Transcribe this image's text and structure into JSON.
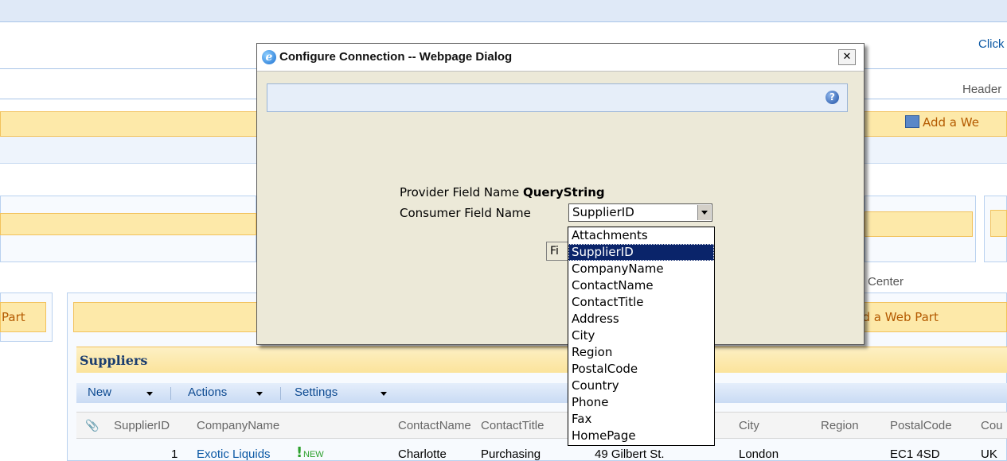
{
  "top_right_link": "Click",
  "header_label": "Header",
  "add_web_part_top": "Add a We",
  "center_label": "Center",
  "left_part_label": "Part",
  "add_web_part_center": "dd a Web Part",
  "dialog": {
    "title": "Configure Connection -- Webpage Dialog",
    "close_glyph": "✕",
    "provider_label": "Provider Field Name",
    "provider_value": "QueryString",
    "consumer_label": "Consumer Field Name",
    "consumer_selected": "SupplierID",
    "finish_button_partial": "Fi",
    "options": [
      "Attachments",
      "SupplierID",
      "CompanyName",
      "ContactName",
      "ContactTitle",
      "Address",
      "City",
      "Region",
      "PostalCode",
      "Country",
      "Phone",
      "Fax",
      "HomePage"
    ],
    "selected_index": 1
  },
  "list": {
    "title": "Suppliers",
    "toolbar": {
      "new": "New",
      "actions": "Actions",
      "settings": "Settings"
    },
    "columns": [
      "SupplierID",
      "CompanyName",
      "ContactName",
      "ContactTitle",
      "City",
      "Region",
      "PostalCode",
      "Cou"
    ],
    "row": {
      "supplier_id": "1",
      "company": "Exotic Liquids",
      "new_badge": "NEW",
      "contact_name": "Charlotte",
      "contact_title": "Purchasing",
      "address": "49 Gilbert St.",
      "city": "London",
      "postal": "EC1 4SD",
      "country": "UK"
    }
  },
  "colors": {
    "accent_orange": "#fde9a9",
    "link_blue": "#0b58a4",
    "selection": "#0a246a"
  }
}
